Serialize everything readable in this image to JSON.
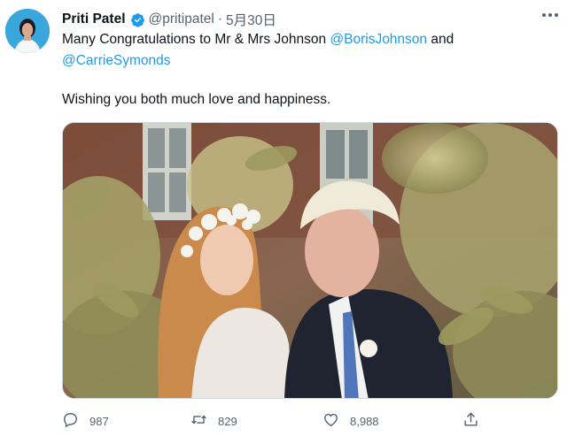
{
  "tweet": {
    "author_name": "Priti Patel",
    "handle": "@pritipatel",
    "separator": "·",
    "date": "5月30日",
    "text_line1_pre": "Many Congratulations to Mr & Mrs Johnson ",
    "mention1": "@BorisJohnson",
    "text_line1_post": " and",
    "mention2": "@CarrieSymonds",
    "text_line3": "Wishing you both much love and happiness."
  },
  "actions": {
    "reply_count": "987",
    "retweet_count": "829",
    "like_count": "8,988"
  },
  "colors": {
    "accent": "#1d9bf0",
    "secondary_text": "#536471",
    "verified": "#1d9bf0"
  },
  "icons": [
    "verified-badge-icon",
    "more-icon",
    "reply-icon",
    "retweet-icon",
    "like-icon",
    "share-icon"
  ]
}
